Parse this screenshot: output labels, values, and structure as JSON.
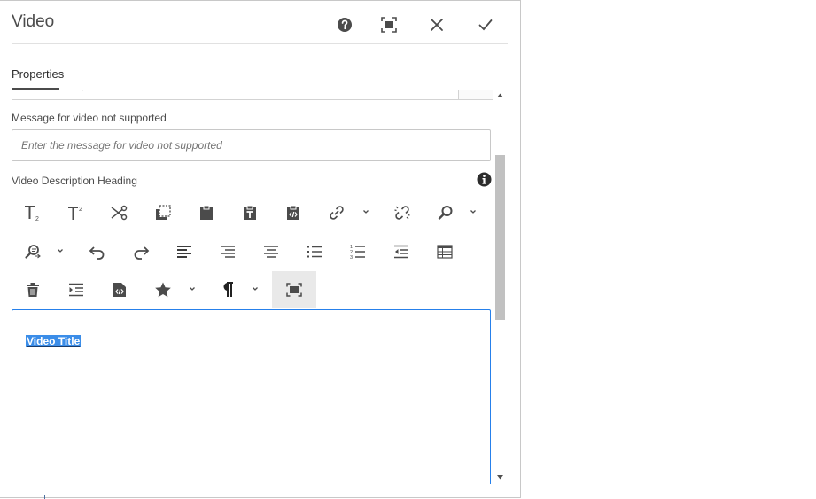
{
  "dialog": {
    "title": "Video",
    "header_buttons": [
      {
        "name": "help",
        "icon": "help-icon"
      },
      {
        "name": "fullscreen",
        "icon": "fullscreen-icon"
      },
      {
        "name": "close",
        "icon": "close-icon"
      },
      {
        "name": "done",
        "icon": "checkmark-icon"
      }
    ]
  },
  "tabs": [
    {
      "label": "Properties",
      "selected": true
    }
  ],
  "fields": {
    "unsupported_message": {
      "label": "Message for video not supported",
      "value": "",
      "placeholder": "Enter the message for video not supported"
    },
    "description_heading": {
      "label": "Video Description Heading",
      "info_icon": "info-icon"
    }
  },
  "rte_toolbar": {
    "rows": [
      [
        "subscript-icon",
        "superscript-icon",
        "cut-icon",
        "copy-icon",
        "paste-icon",
        "paste-plain-text-icon",
        "paste-word-icon",
        "link-icon",
        "unlink-icon",
        "find-icon"
      ],
      [
        "find-replace-icon",
        "undo-icon",
        "redo-icon",
        "align-left-icon",
        "align-right-icon",
        "align-center-icon",
        "bulleted-list-icon",
        "numbered-list-icon",
        "outdent-icon",
        "table-icon"
      ],
      [
        "delete-icon",
        "indent-icon",
        "source-edit-icon",
        "styles-icon",
        "paragraph-format-icon",
        "fullscreen-icon"
      ]
    ],
    "active": "fullscreen-icon"
  },
  "editor": {
    "content": "Video Title"
  },
  "colors": {
    "accent": "#2680eb",
    "selection": "#3b8de8",
    "icon": "#4b4b4b"
  }
}
